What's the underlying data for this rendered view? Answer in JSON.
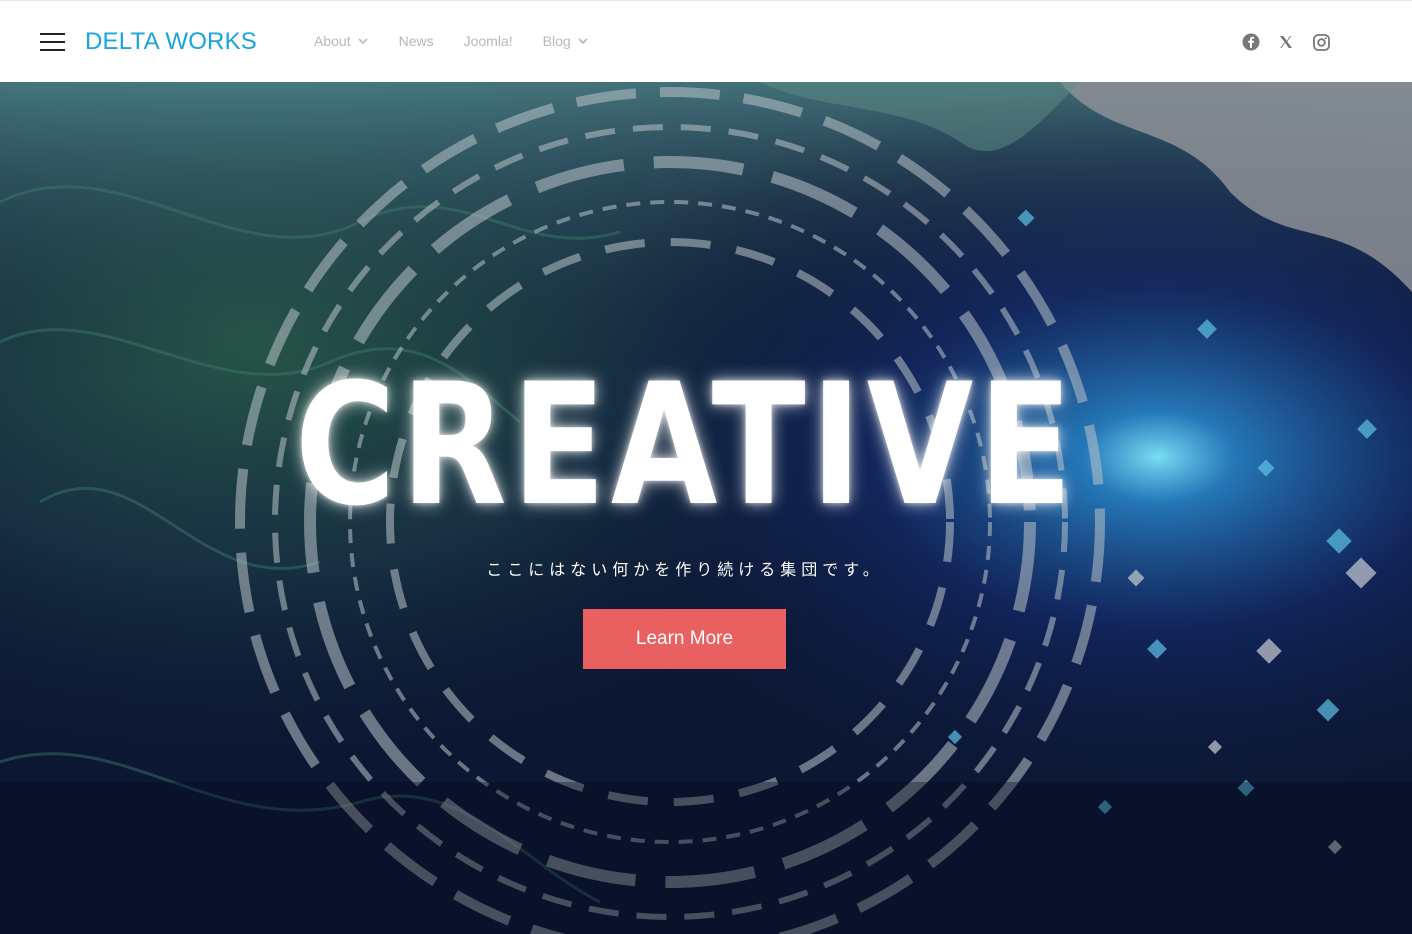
{
  "header": {
    "logo": "DELTA WORKS",
    "nav": [
      {
        "label": "About",
        "has_dropdown": true
      },
      {
        "label": "News",
        "has_dropdown": false
      },
      {
        "label": "Joomla!",
        "has_dropdown": false
      },
      {
        "label": "Blog",
        "has_dropdown": true
      }
    ],
    "social": [
      "facebook-icon",
      "x-icon",
      "instagram-icon"
    ]
  },
  "hero": {
    "title": "CREATIVE",
    "subtitle": "ここにはない何かを作り続ける集団です。",
    "cta_label": "Learn More"
  },
  "colors": {
    "logo": "#1aa3dc",
    "nav_text": "#b8b8b8",
    "cta_bg": "#e8605f",
    "hero_bg": "#0b1530"
  }
}
